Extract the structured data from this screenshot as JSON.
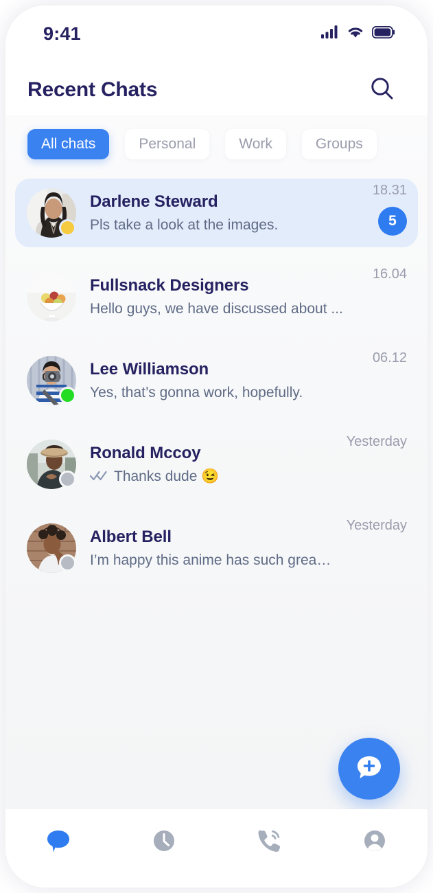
{
  "status_bar": {
    "time": "9:41",
    "signal_icon": "cellular-signal-icon",
    "wifi_icon": "wifi-icon",
    "battery_icon": "battery-full-icon"
  },
  "header": {
    "title": "Recent Chats",
    "search_icon": "search-icon"
  },
  "filters": {
    "items": [
      {
        "label": "All chats",
        "active": true
      },
      {
        "label": "Personal",
        "active": false
      },
      {
        "label": "Work",
        "active": false
      },
      {
        "label": "Groups",
        "active": false
      }
    ]
  },
  "chats": [
    {
      "name": "Darlene Steward",
      "preview": "Pls take a look at the images.",
      "time": "18.31",
      "badge": "5",
      "status": "away",
      "read_receipt": false,
      "selected": true
    },
    {
      "name": "Fullsnack Designers",
      "preview": "Hello guys, we have discussed about ...",
      "time": "16.04",
      "badge": "",
      "status": "none",
      "read_receipt": false,
      "selected": false
    },
    {
      "name": "Lee Williamson",
      "preview": "Yes, that’s gonna work, hopefully.",
      "time": "06.12",
      "badge": "",
      "status": "online",
      "read_receipt": false,
      "selected": false
    },
    {
      "name": "Ronald Mccoy",
      "preview": "Thanks dude 😉",
      "time": "Yesterday",
      "badge": "",
      "status": "offline",
      "read_receipt": true,
      "selected": false
    },
    {
      "name": "Albert Bell",
      "preview": "I’m happy this anime has such grea…",
      "time": "Yesterday",
      "badge": "",
      "status": "offline",
      "read_receipt": false,
      "selected": false
    }
  ],
  "fab": {
    "icon": "new-chat-icon"
  },
  "bottom_nav": {
    "items": [
      {
        "icon": "chat-bubble-icon",
        "active": true
      },
      {
        "icon": "clock-icon",
        "active": false
      },
      {
        "icon": "phone-call-icon",
        "active": false
      },
      {
        "icon": "profile-icon",
        "active": false
      }
    ]
  },
  "colors": {
    "accent": "#3b82f1",
    "badge": "#2f7cf0",
    "title": "#262261",
    "muted": "#9a9cad",
    "preview": "#5f6b86",
    "selected_row": "#e3ecfb",
    "online": "#23dc23",
    "away": "#f7cb3f",
    "offline": "#b7bcc4"
  }
}
